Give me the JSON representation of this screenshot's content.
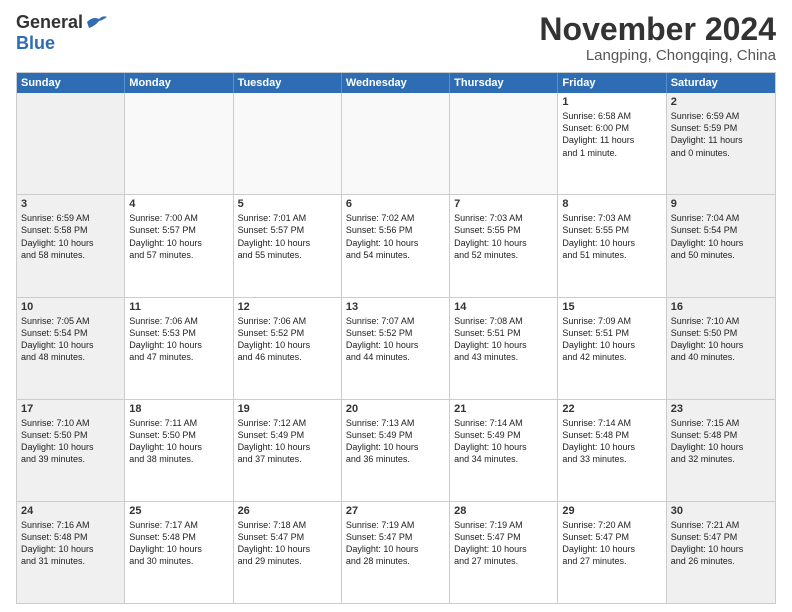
{
  "logo": {
    "line1": "General",
    "line2": "Blue"
  },
  "title": "November 2024",
  "location": "Langping, Chongqing, China",
  "header_days": [
    "Sunday",
    "Monday",
    "Tuesday",
    "Wednesday",
    "Thursday",
    "Friday",
    "Saturday"
  ],
  "weeks": [
    [
      {
        "day": "",
        "info": "",
        "empty": true
      },
      {
        "day": "",
        "info": "",
        "empty": true
      },
      {
        "day": "",
        "info": "",
        "empty": true
      },
      {
        "day": "",
        "info": "",
        "empty": true
      },
      {
        "day": "",
        "info": "",
        "empty": true
      },
      {
        "day": "1",
        "info": "Sunrise: 6:58 AM\nSunset: 6:00 PM\nDaylight: 11 hours\nand 1 minute.",
        "empty": false
      },
      {
        "day": "2",
        "info": "Sunrise: 6:59 AM\nSunset: 5:59 PM\nDaylight: 11 hours\nand 0 minutes.",
        "empty": false
      }
    ],
    [
      {
        "day": "3",
        "info": "Sunrise: 6:59 AM\nSunset: 5:58 PM\nDaylight: 10 hours\nand 58 minutes.",
        "empty": false
      },
      {
        "day": "4",
        "info": "Sunrise: 7:00 AM\nSunset: 5:57 PM\nDaylight: 10 hours\nand 57 minutes.",
        "empty": false
      },
      {
        "day": "5",
        "info": "Sunrise: 7:01 AM\nSunset: 5:57 PM\nDaylight: 10 hours\nand 55 minutes.",
        "empty": false
      },
      {
        "day": "6",
        "info": "Sunrise: 7:02 AM\nSunset: 5:56 PM\nDaylight: 10 hours\nand 54 minutes.",
        "empty": false
      },
      {
        "day": "7",
        "info": "Sunrise: 7:03 AM\nSunset: 5:55 PM\nDaylight: 10 hours\nand 52 minutes.",
        "empty": false
      },
      {
        "day": "8",
        "info": "Sunrise: 7:03 AM\nSunset: 5:55 PM\nDaylight: 10 hours\nand 51 minutes.",
        "empty": false
      },
      {
        "day": "9",
        "info": "Sunrise: 7:04 AM\nSunset: 5:54 PM\nDaylight: 10 hours\nand 50 minutes.",
        "empty": false
      }
    ],
    [
      {
        "day": "10",
        "info": "Sunrise: 7:05 AM\nSunset: 5:54 PM\nDaylight: 10 hours\nand 48 minutes.",
        "empty": false
      },
      {
        "day": "11",
        "info": "Sunrise: 7:06 AM\nSunset: 5:53 PM\nDaylight: 10 hours\nand 47 minutes.",
        "empty": false
      },
      {
        "day": "12",
        "info": "Sunrise: 7:06 AM\nSunset: 5:52 PM\nDaylight: 10 hours\nand 46 minutes.",
        "empty": false
      },
      {
        "day": "13",
        "info": "Sunrise: 7:07 AM\nSunset: 5:52 PM\nDaylight: 10 hours\nand 44 minutes.",
        "empty": false
      },
      {
        "day": "14",
        "info": "Sunrise: 7:08 AM\nSunset: 5:51 PM\nDaylight: 10 hours\nand 43 minutes.",
        "empty": false
      },
      {
        "day": "15",
        "info": "Sunrise: 7:09 AM\nSunset: 5:51 PM\nDaylight: 10 hours\nand 42 minutes.",
        "empty": false
      },
      {
        "day": "16",
        "info": "Sunrise: 7:10 AM\nSunset: 5:50 PM\nDaylight: 10 hours\nand 40 minutes.",
        "empty": false
      }
    ],
    [
      {
        "day": "17",
        "info": "Sunrise: 7:10 AM\nSunset: 5:50 PM\nDaylight: 10 hours\nand 39 minutes.",
        "empty": false
      },
      {
        "day": "18",
        "info": "Sunrise: 7:11 AM\nSunset: 5:50 PM\nDaylight: 10 hours\nand 38 minutes.",
        "empty": false
      },
      {
        "day": "19",
        "info": "Sunrise: 7:12 AM\nSunset: 5:49 PM\nDaylight: 10 hours\nand 37 minutes.",
        "empty": false
      },
      {
        "day": "20",
        "info": "Sunrise: 7:13 AM\nSunset: 5:49 PM\nDaylight: 10 hours\nand 36 minutes.",
        "empty": false
      },
      {
        "day": "21",
        "info": "Sunrise: 7:14 AM\nSunset: 5:49 PM\nDaylight: 10 hours\nand 34 minutes.",
        "empty": false
      },
      {
        "day": "22",
        "info": "Sunrise: 7:14 AM\nSunset: 5:48 PM\nDaylight: 10 hours\nand 33 minutes.",
        "empty": false
      },
      {
        "day": "23",
        "info": "Sunrise: 7:15 AM\nSunset: 5:48 PM\nDaylight: 10 hours\nand 32 minutes.",
        "empty": false
      }
    ],
    [
      {
        "day": "24",
        "info": "Sunrise: 7:16 AM\nSunset: 5:48 PM\nDaylight: 10 hours\nand 31 minutes.",
        "empty": false
      },
      {
        "day": "25",
        "info": "Sunrise: 7:17 AM\nSunset: 5:48 PM\nDaylight: 10 hours\nand 30 minutes.",
        "empty": false
      },
      {
        "day": "26",
        "info": "Sunrise: 7:18 AM\nSunset: 5:47 PM\nDaylight: 10 hours\nand 29 minutes.",
        "empty": false
      },
      {
        "day": "27",
        "info": "Sunrise: 7:19 AM\nSunset: 5:47 PM\nDaylight: 10 hours\nand 28 minutes.",
        "empty": false
      },
      {
        "day": "28",
        "info": "Sunrise: 7:19 AM\nSunset: 5:47 PM\nDaylight: 10 hours\nand 27 minutes.",
        "empty": false
      },
      {
        "day": "29",
        "info": "Sunrise: 7:20 AM\nSunset: 5:47 PM\nDaylight: 10 hours\nand 27 minutes.",
        "empty": false
      },
      {
        "day": "30",
        "info": "Sunrise: 7:21 AM\nSunset: 5:47 PM\nDaylight: 10 hours\nand 26 minutes.",
        "empty": false
      }
    ]
  ]
}
